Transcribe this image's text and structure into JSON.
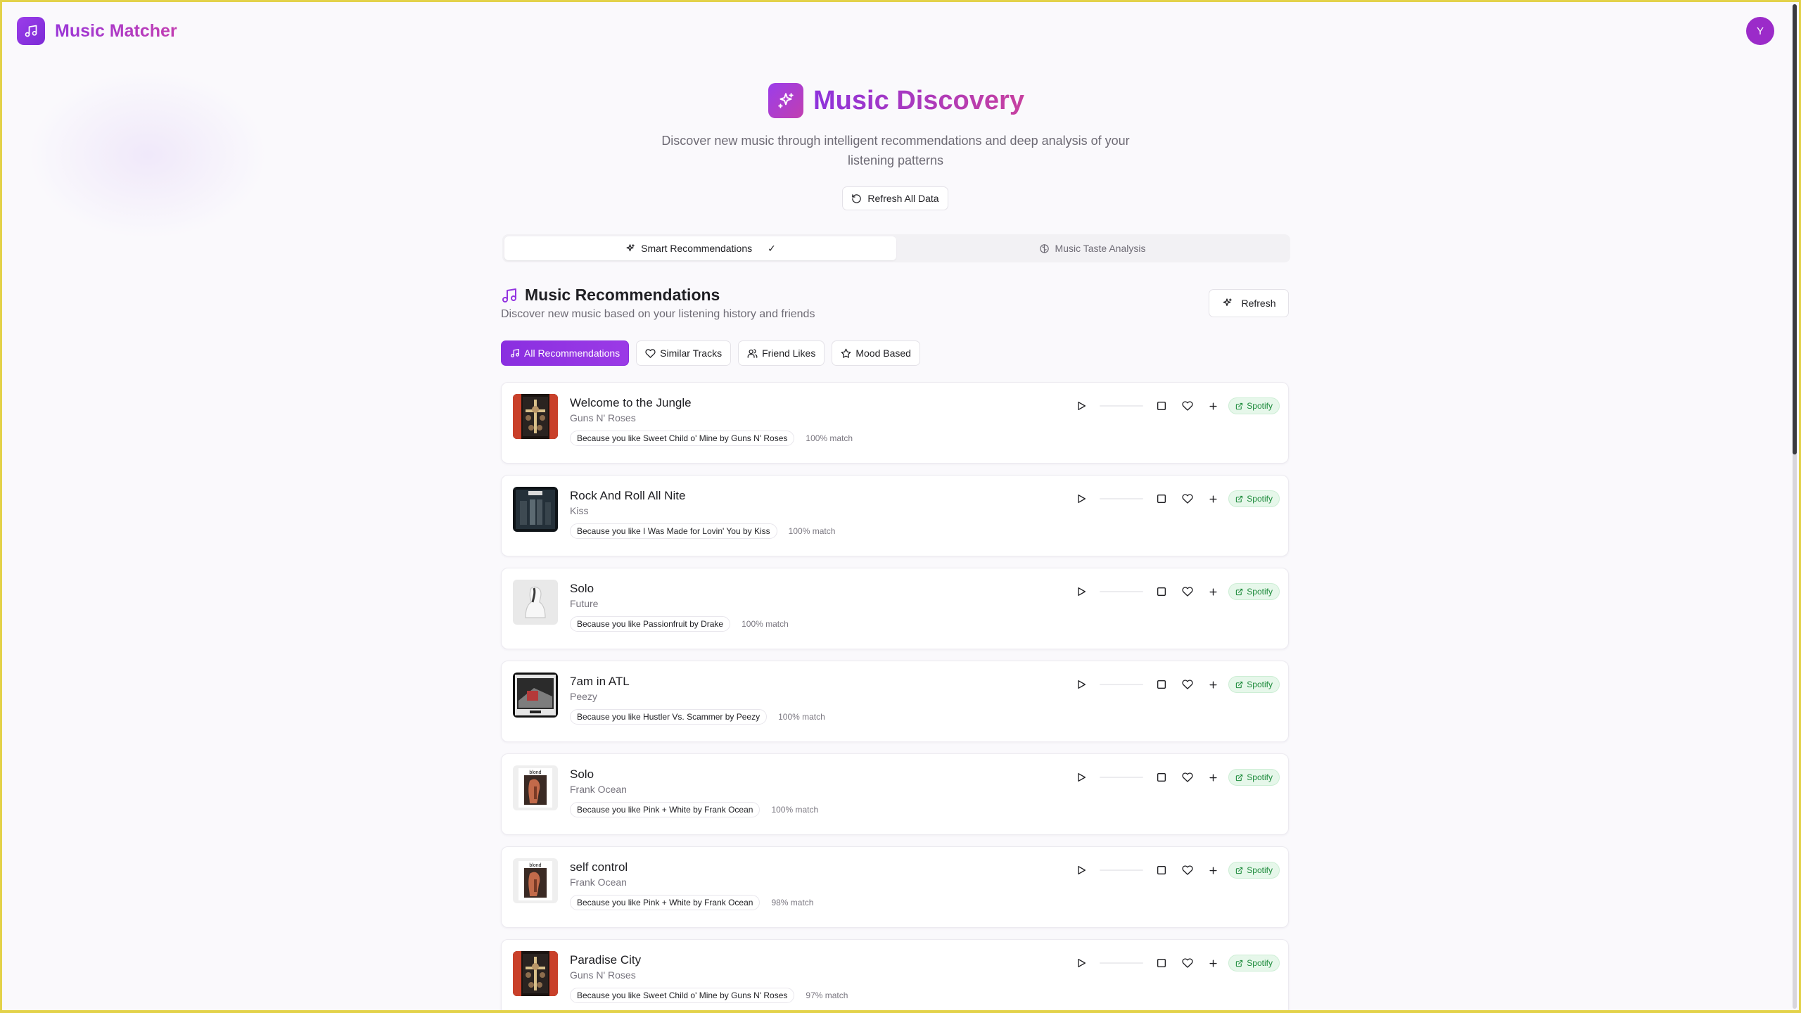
{
  "app": {
    "name": "Music Matcher",
    "avatar_initial": "Y"
  },
  "hero": {
    "title": "Music Discovery",
    "subtitle": "Discover new music through intelligent recommendations and deep analysis of your listening patterns",
    "refresh_all_label": "Refresh All Data"
  },
  "main_tabs": [
    {
      "label": "Smart Recommendations",
      "check": "✓"
    },
    {
      "label": "Music Taste Analysis"
    }
  ],
  "section": {
    "title": "Music Recommendations",
    "subtitle": "Discover new music based on your listening history and friends",
    "refresh_label": "Refresh"
  },
  "filters": [
    {
      "label": "All Recommendations",
      "icon": "music-note-icon"
    },
    {
      "label": "Similar Tracks",
      "icon": "heart-icon"
    },
    {
      "label": "Friend Likes",
      "icon": "users-icon"
    },
    {
      "label": "Mood Based",
      "icon": "star-icon"
    }
  ],
  "spotify_label": "Spotify",
  "tracks": [
    {
      "title": "Welcome to the Jungle",
      "artist": "Guns N' Roses",
      "reason": "Because you like Sweet Child o' Mine by Guns N' Roses",
      "match": "100% match",
      "art": "gnr"
    },
    {
      "title": "Rock And Roll All Nite",
      "artist": "Kiss",
      "reason": "Because you like I Was Made for Lovin' You by Kiss",
      "match": "100% match",
      "art": "kiss"
    },
    {
      "title": "Solo",
      "artist": "Future",
      "reason": "Because you like Passionfruit by Drake",
      "match": "100% match",
      "art": "future"
    },
    {
      "title": "7am in ATL",
      "artist": "Peezy",
      "reason": "Because you like Hustler Vs. Scammer by Peezy",
      "match": "100% match",
      "art": "peezy"
    },
    {
      "title": "Solo",
      "artist": "Frank Ocean",
      "reason": "Because you like Pink + White by Frank Ocean",
      "match": "100% match",
      "art": "blond"
    },
    {
      "title": "self control",
      "artist": "Frank Ocean",
      "reason": "Because you like Pink + White by Frank Ocean",
      "match": "98% match",
      "art": "blond"
    },
    {
      "title": "Paradise City",
      "artist": "Guns N' Roses",
      "reason": "Because you like Sweet Child o' Mine by Guns N' Roses",
      "match": "97% match",
      "art": "gnr"
    }
  ]
}
